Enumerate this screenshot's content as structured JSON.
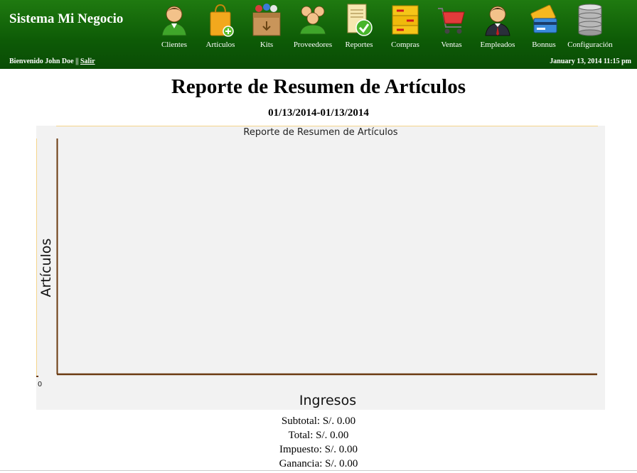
{
  "header": {
    "app_title": "Sistema Mi Negocio",
    "welcome_prefix": "Bienvenido John Doe || ",
    "logout_label": "Salir",
    "datetime": "January 13, 2014 11:15 pm",
    "nav": [
      {
        "label": "Clientes",
        "icon": "customers-icon"
      },
      {
        "label": "Artículos",
        "icon": "items-bag-icon"
      },
      {
        "label": "Kits",
        "icon": "kits-box-icon"
      },
      {
        "label": "Proveedores",
        "icon": "suppliers-icon"
      },
      {
        "label": "Reportes",
        "icon": "reports-icon"
      },
      {
        "label": "Compras",
        "icon": "purchases-boxes-icon"
      },
      {
        "label": "Ventas",
        "icon": "cart-icon"
      },
      {
        "label": "Empleados",
        "icon": "employee-icon"
      },
      {
        "label": "Bonnus",
        "icon": "cards-icon"
      },
      {
        "label": "Configuración",
        "icon": "database-icon"
      }
    ]
  },
  "report": {
    "title": "Reporte de Resumen de Artículos",
    "date_range": "01/13/2014-01/13/2014"
  },
  "chart_data": {
    "type": "bar",
    "title": "Reporte de Resumen de Artículos",
    "xlabel": "Ingresos",
    "ylabel": "Artículos",
    "categories": [],
    "values": [],
    "x_tick_labels": [
      "0"
    ],
    "colors": {
      "background": "#f2f2f2",
      "axis": "#6b3a10"
    }
  },
  "totals": {
    "subtotal": "Subtotal: S/. 0.00",
    "total": "Total: S/. 0.00",
    "tax": "Impuesto: S/. 0.00",
    "profit": "Ganancia: S/. 0.00"
  }
}
